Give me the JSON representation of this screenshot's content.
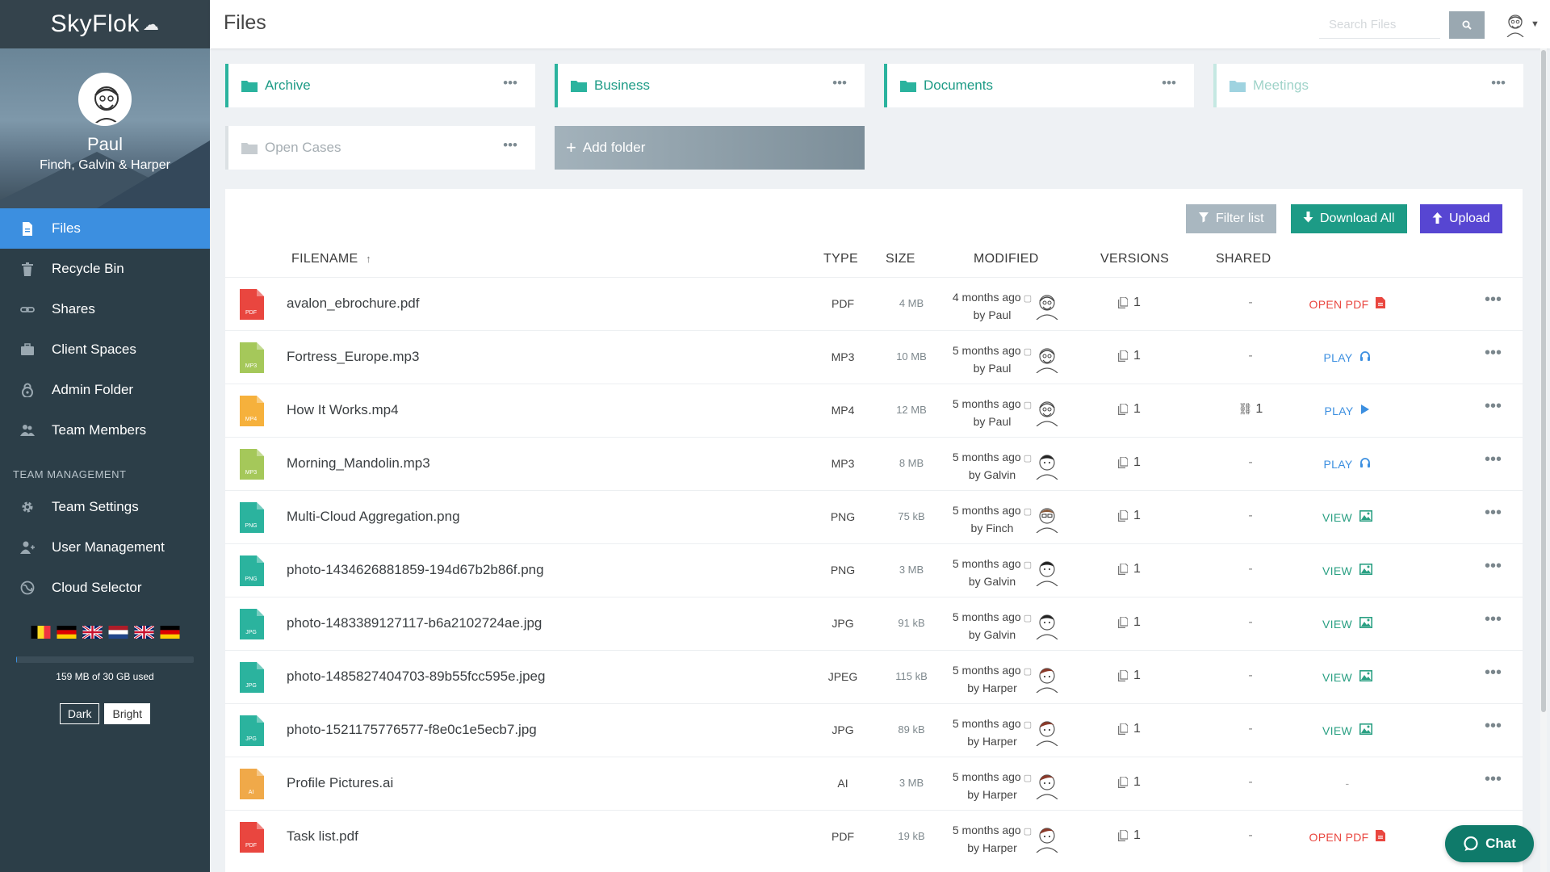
{
  "app": {
    "logo_text": "SkyFlok"
  },
  "profile": {
    "name": "Paul",
    "company": "Finch, Galvin & Harper"
  },
  "sidebar": {
    "items": [
      {
        "label": "Files",
        "icon": "file-icon"
      },
      {
        "label": "Recycle Bin",
        "icon": "trash-icon"
      },
      {
        "label": "Shares",
        "icon": "link-icon"
      },
      {
        "label": "Client Spaces",
        "icon": "briefcase-icon"
      },
      {
        "label": "Admin Folder",
        "icon": "lock-icon"
      },
      {
        "label": "Team Members",
        "icon": "users-icon"
      }
    ],
    "section_title": "TEAM MANAGEMENT",
    "management_items": [
      {
        "label": "Team Settings",
        "icon": "gear-icon"
      },
      {
        "label": "User Management",
        "icon": "user-add-icon"
      },
      {
        "label": "Cloud Selector",
        "icon": "globe-icon"
      }
    ],
    "storage": {
      "text": "159 MB of 30 GB used",
      "used_fraction": 0.005
    },
    "theme": {
      "dark": "Dark",
      "bright": "Bright"
    }
  },
  "header": {
    "title": "Files",
    "search_placeholder": "Search Files"
  },
  "folders": [
    {
      "name": "Archive"
    },
    {
      "name": "Business"
    },
    {
      "name": "Documents"
    },
    {
      "name": "Meetings"
    },
    {
      "name": "Open Cases"
    }
  ],
  "add_folder_label": "Add folder",
  "toolbar": {
    "filter": "Filter list",
    "download": "Download All",
    "upload": "Upload"
  },
  "columns": {
    "filename": "FILENAME",
    "type": "TYPE",
    "size": "SIZE",
    "modified": "MODIFIED",
    "versions": "VERSIONS",
    "shared": "SHARED"
  },
  "colors": {
    "pdf": "#e9463f",
    "mp3": "#a5c85a",
    "mp4": "#f6b13c",
    "png": "#2bb39e",
    "ai": "#f0a949",
    "view": "#2aa083",
    "play": "#3c8fe0",
    "open_pdf": "#e9463f"
  },
  "files": [
    {
      "name": "avalon_ebrochure.pdf",
      "badge": "PDF",
      "type": "PDF",
      "size": "4 MB",
      "modified": "4 months ago",
      "by": "by Paul",
      "versions": "1",
      "shared": "-",
      "action": "OPEN PDF",
      "action_kind": "open_pdf",
      "action_icon": "pdf-icon"
    },
    {
      "name": "Fortress_Europe.mp3",
      "badge": "MP3",
      "type": "MP3",
      "size": "10 MB",
      "modified": "5 months ago",
      "by": "by Paul",
      "versions": "1",
      "shared": "-",
      "action": "PLAY",
      "action_kind": "play",
      "action_icon": "headphones-icon"
    },
    {
      "name": "How It Works.mp4",
      "badge": "MP4",
      "type": "MP4",
      "size": "12 MB",
      "modified": "5 months ago",
      "by": "by Paul",
      "versions": "1",
      "shared": "1",
      "action": "PLAY",
      "action_kind": "play",
      "action_icon": "play-icon"
    },
    {
      "name": "Morning_Mandolin.mp3",
      "badge": "MP3",
      "type": "MP3",
      "size": "8 MB",
      "modified": "5 months ago",
      "by": "by Galvin",
      "versions": "1",
      "shared": "-",
      "action": "PLAY",
      "action_kind": "play",
      "action_icon": "headphones-icon"
    },
    {
      "name": "Multi-Cloud Aggregation.png",
      "badge": "PNG",
      "type": "PNG",
      "size": "75 kB",
      "modified": "5 months ago",
      "by": "by Finch",
      "versions": "1",
      "shared": "-",
      "action": "VIEW",
      "action_kind": "view",
      "action_icon": "image-icon"
    },
    {
      "name": "photo-1434626881859-194d67b2b86f.png",
      "badge": "PNG",
      "type": "PNG",
      "size": "3 MB",
      "modified": "5 months ago",
      "by": "by Galvin",
      "versions": "1",
      "shared": "-",
      "action": "VIEW",
      "action_kind": "view",
      "action_icon": "image-icon"
    },
    {
      "name": "photo-1483389127117-b6a2102724ae.jpg",
      "badge": "JPG",
      "type": "JPG",
      "size": "91 kB",
      "modified": "5 months ago",
      "by": "by Galvin",
      "versions": "1",
      "shared": "-",
      "action": "VIEW",
      "action_kind": "view",
      "action_icon": "image-icon"
    },
    {
      "name": "photo-1485827404703-89b55fcc595e.jpeg",
      "badge": "JPG",
      "type": "JPEG",
      "size": "115 kB",
      "modified": "5 months ago",
      "by": "by Harper",
      "versions": "1",
      "shared": "-",
      "action": "VIEW",
      "action_kind": "view",
      "action_icon": "image-icon"
    },
    {
      "name": "photo-1521175776577-f8e0c1e5ecb7.jpg",
      "badge": "JPG",
      "type": "JPG",
      "size": "89 kB",
      "modified": "5 months ago",
      "by": "by Harper",
      "versions": "1",
      "shared": "-",
      "action": "VIEW",
      "action_kind": "view",
      "action_icon": "image-icon"
    },
    {
      "name": "Profile Pictures.ai",
      "badge": "AI",
      "type": "AI",
      "size": "3 MB",
      "modified": "5 months ago",
      "by": "by Harper",
      "versions": "1",
      "shared": "-",
      "action": "-",
      "action_kind": "none",
      "action_icon": ""
    },
    {
      "name": "Task list.pdf",
      "badge": "PDF",
      "type": "PDF",
      "size": "19 kB",
      "modified": "5 months ago",
      "by": "by Harper",
      "versions": "1",
      "shared": "-",
      "action": "OPEN PDF",
      "action_kind": "open_pdf",
      "action_icon": "pdf-icon"
    }
  ],
  "chat_label": "Chat"
}
